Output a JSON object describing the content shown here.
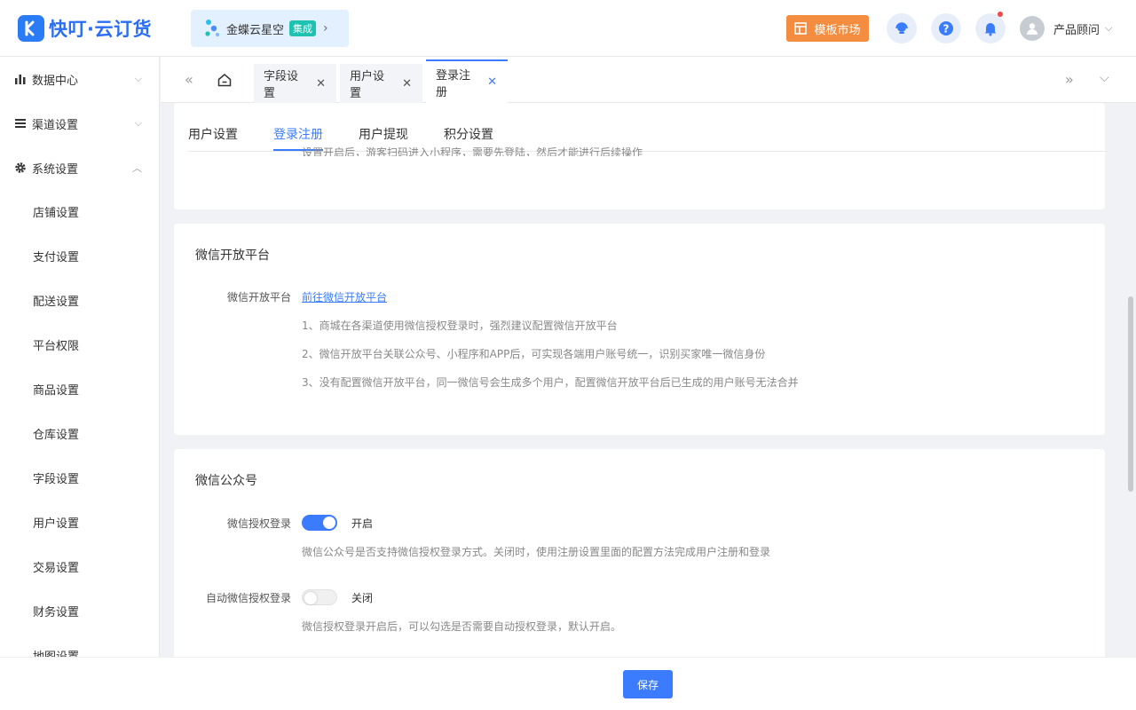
{
  "header": {
    "logo_text": "快叮·云订货",
    "integration": {
      "name": "金蝶云星空",
      "badge": "集成",
      "arrow": "›"
    },
    "template_market": "模板市场",
    "user_name": "产品顾问"
  },
  "sidebar": {
    "groups": [
      {
        "label": "数据中心",
        "icon": "bar-chart-icon",
        "expanded": false
      },
      {
        "label": "渠道设置",
        "icon": "list-icon",
        "expanded": false
      },
      {
        "label": "系统设置",
        "icon": "gear-icon",
        "expanded": true
      }
    ],
    "items": [
      "店铺设置",
      "支付设置",
      "配送设置",
      "平台权限",
      "商品设置",
      "仓库设置",
      "字段设置",
      "用户设置",
      "交易设置",
      "财务设置",
      "地图设置"
    ]
  },
  "page_tabs": [
    {
      "label": "字段设置",
      "active": false
    },
    {
      "label": "用户设置",
      "active": false
    },
    {
      "label": "登录注册",
      "active": true
    }
  ],
  "sub_tabs": [
    {
      "label": "用户设置",
      "active": false
    },
    {
      "label": "登录注册",
      "active": true
    },
    {
      "label": "用户提现",
      "active": false
    },
    {
      "label": "积分设置",
      "active": false
    }
  ],
  "top_card_note": "设置开启后，游客扫码进入小程序，需要先登陆，然后才能进行后续操作",
  "wechat_open": {
    "title": "微信开放平台",
    "label": "微信开放平台",
    "link": "前往微信开放平台",
    "notes": [
      "1、商城在各渠道使用微信授权登录时，强烈建议配置微信开放平台",
      "2、微信开放平台关联公众号、小程序和APP后，可实现各端用户账号统一，识别买家唯一微信身份",
      "3、没有配置微信开放平台，同一微信号会生成多个用户，配置微信开放平台后已生成的用户账号无法合并"
    ]
  },
  "wechat_mp": {
    "title": "微信公众号",
    "auth_login": {
      "label": "微信授权登录",
      "state": "开启",
      "on": true,
      "note": "微信公众号是否支持微信授权登录方式。关闭时，使用注册设置里面的配置方法完成用户注册和登录"
    },
    "auto_auth": {
      "label": "自动微信授权登录",
      "state": "关闭",
      "on": false,
      "note": "微信授权登录开启后，可以勾选是否需要自动授权登录，默认开启。"
    }
  },
  "footer": {
    "save": "保存"
  },
  "colors": {
    "primary": "#3b7cff",
    "template_button": "#f48d3f",
    "badge": "#1fc1b1",
    "logo": "#2a7cf6"
  }
}
